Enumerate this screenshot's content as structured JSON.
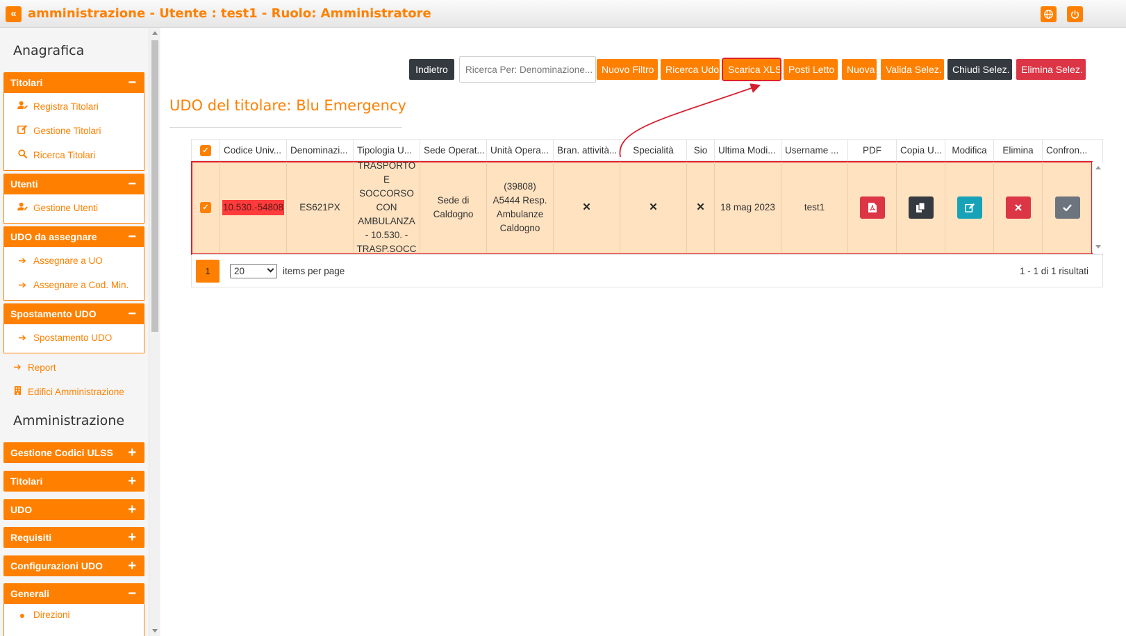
{
  "topbar": {
    "title": "amministrazione - Utente : test1 - Ruolo: Amministratore",
    "back_icon": "«"
  },
  "sidebar": {
    "heading_anagrafica": "Anagrafica",
    "groups": [
      {
        "title": "Titolari",
        "sign": "−",
        "items": [
          {
            "label": "Registra Titolari",
            "icon": "user-edit-icon"
          },
          {
            "label": "Gestione Titolari",
            "icon": "edit-icon"
          },
          {
            "label": "Ricerca Titolari",
            "icon": "search-icon"
          }
        ]
      },
      {
        "title": "Utenti",
        "sign": "−",
        "items": [
          {
            "label": "Gestione Utenti",
            "icon": "user-edit-icon"
          }
        ]
      },
      {
        "title": "UDO da assegnare",
        "sign": "−",
        "items": [
          {
            "label": "Assegnare a UO",
            "icon": "arrow-right-icon"
          },
          {
            "label": "Assegnare a Cod. Min.",
            "icon": "arrow-right-icon"
          }
        ]
      },
      {
        "title": "Spostamento UDO",
        "sign": "−",
        "items": [
          {
            "label": "Spostamento UDO",
            "icon": "arrow-right-icon"
          }
        ]
      }
    ],
    "loose_items": [
      {
        "label": "Report",
        "icon": "arrow-right-icon"
      },
      {
        "label": "Edifici Amministrazione",
        "icon": "building-icon"
      }
    ],
    "heading_amministrazione": "Amministrazione",
    "collapsed_groups": [
      {
        "title": "Gestione Codici ULSS",
        "sign": "+"
      },
      {
        "title": "Titolari",
        "sign": "+"
      },
      {
        "title": "UDO",
        "sign": "+"
      },
      {
        "title": "Requisiti",
        "sign": "+"
      },
      {
        "title": "Configurazioni UDO",
        "sign": "+"
      },
      {
        "title": "Generali",
        "sign": "−"
      }
    ],
    "partial_item": "Direzioni"
  },
  "toolbar": {
    "back": "Indietro",
    "search_placeholder": "Ricerca Per: Denominazione...",
    "new_filter": "Nuovo Filtro",
    "search_udo": "Ricerca Udo",
    "download_xls": "Scarica XLS",
    "beds": "Posti Letto",
    "new": "Nuova",
    "validate_sel": "Valida Selez.",
    "close_sel": "Chiudi Selez.",
    "delete_sel": "Elimina Selez."
  },
  "page_title": "UDO del titolare: Blu Emergency",
  "grid": {
    "headers": [
      "Codice Univ...",
      "Denominazi...",
      "Tipologia U...",
      "Sede Operat...",
      "Unità Opera...",
      "Bran. attività...",
      "Specialità",
      "Sio",
      "Ultima Modi...",
      "Username ...",
      "PDF",
      "Copia U...",
      "Modifica",
      "Elimina",
      "Confron..."
    ],
    "row": {
      "code": "10.530.-54808",
      "denominazione": "ES621PX",
      "tipologia": "TRASPORTO E SOCCORSO CON AMBULANZA - 10.530. - TRASP.SOCC",
      "sede": "Sede di Caldogno",
      "unita": "(39808) A5444 Resp. Ambulanze Caldogno",
      "branca": "✕",
      "specialita": "✕",
      "sio": "✕",
      "ultima_modifica": "18 mag 2023",
      "username": "test1"
    }
  },
  "pager": {
    "page": "1",
    "page_size": "20",
    "items_per_page": "items per page",
    "result": "1 - 1 di 1 risultati"
  },
  "colors": {
    "accent": "#ff8000",
    "dark": "#343a40",
    "danger": "#dc3545",
    "info": "#17a2b8",
    "secondary": "#6c757d",
    "row_selected": "#ffe2c0"
  }
}
